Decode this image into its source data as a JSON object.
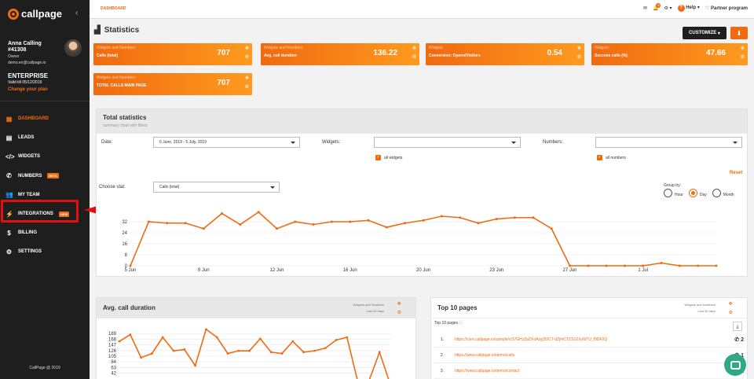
{
  "sidebar": {
    "brand": "callpage",
    "user_name": "Anna Calling",
    "user_id": "#41308",
    "user_role": "Owner",
    "user_email": "demo.en@callpage.io",
    "plan_name": "ENTERPRISE",
    "plan_valid": "Valid till 05/12/2019",
    "change_plan": "Change your plan",
    "items": [
      {
        "label": "DASHBOARD",
        "icon": "dashboard-icon",
        "glyph": "▦"
      },
      {
        "label": "LEADS",
        "icon": "leads-icon",
        "glyph": "▤"
      },
      {
        "label": "WIDGETS",
        "icon": "code-icon",
        "glyph": "</>"
      },
      {
        "label": "NUMBERS",
        "icon": "phone-icon",
        "glyph": "✆",
        "badge": "BETA"
      },
      {
        "label": "MY TEAM",
        "icon": "team-icon",
        "glyph": "👥"
      },
      {
        "label": "INTEGRATIONS",
        "icon": "plug-icon",
        "glyph": "⚡",
        "badge": "NEW"
      },
      {
        "label": "BILLING",
        "icon": "dollar-icon",
        "glyph": "$"
      },
      {
        "label": "SETTINGS",
        "icon": "gear-icon",
        "glyph": "⚙"
      }
    ],
    "copyright": "CallPage @ 2019"
  },
  "topbar": {
    "breadcrumb": "DASHBOARD",
    "notif_count": "8",
    "help": "Help",
    "partner": "Partner program"
  },
  "stats": {
    "title": "Statistics",
    "customize": "CUSTOMIZE",
    "widgets": [
      {
        "tag": "Widgets and Numbers",
        "label": "Calls (total)",
        "value": "707"
      },
      {
        "tag": "Widgets and Numbers",
        "label": "Avg. call duration",
        "value": "136.22"
      },
      {
        "tag": "Widgets",
        "label": "Conversion: Opens/Visitors",
        "value": "0.54"
      },
      {
        "tag": "Widgets",
        "label": "Success calls (%)",
        "value": "47.66"
      },
      {
        "tag": "Widgets and Numbers",
        "label": "TOTAL CALLS MAIN PAGE",
        "value": "707"
      }
    ]
  },
  "total": {
    "title": "Total statistics",
    "subtitle": "summary chart with filters",
    "date_label": "Date:",
    "date_value": "6 June, 2019 - 5 July, 2019",
    "widgets_label": "Widgets:",
    "all_widgets": "all widgets",
    "numbers_label": "Numbers:",
    "all_numbers": "all numbers",
    "reset": "Reset",
    "choose_stat": "Choose stat:",
    "stat_value": "Calls (total)",
    "group_by": "Group by:",
    "group_options": [
      "Hour",
      "Day",
      "Month"
    ],
    "group_selected": "Day"
  },
  "avg": {
    "title": "Avg. call duration",
    "tag1": "Widgets and Numbers",
    "tag2": "Last 30 days"
  },
  "top10": {
    "title": "Top 10 pages",
    "tag1": "Widgets and Numbers",
    "tag2": "Last 30 days",
    "subtitle": "Top 10 pages",
    "rows": [
      {
        "n": "1.",
        "url": "https://core.callpage.io/sample/cO7GHzZpZXoAzyj3OC7-dZjmCTZS1ZXyIbTU_f9DF0Q",
        "count": "2"
      },
      {
        "n": "2.",
        "url": "https://www.callpage.io/demo/calls",
        "count": "1"
      },
      {
        "n": "3.",
        "url": "https://www.callpage.io/demo/contact",
        "count": "1"
      }
    ]
  },
  "chart_data": [
    {
      "type": "line",
      "title": "",
      "xlabel": "",
      "ylabel": "",
      "ylim": [
        0,
        40
      ],
      "yticks": [
        0,
        8,
        16,
        24,
        32
      ],
      "xticks": [
        "5 Jun",
        "9 Jun",
        "12 Jun",
        "16 Jun",
        "20 Jun",
        "23 Jun",
        "27 Jun",
        "1 Jul"
      ],
      "xtick_index": [
        0,
        4,
        8,
        12,
        16,
        20,
        24,
        28
      ],
      "color": "#f06a10",
      "values": [
        0,
        32,
        31,
        31,
        27,
        38,
        30,
        39,
        27,
        32,
        30,
        32,
        32,
        33,
        28,
        31,
        33,
        36,
        35,
        31,
        34,
        35,
        35,
        27,
        0,
        0,
        0,
        0,
        0,
        2,
        0,
        0,
        0
      ]
    },
    {
      "type": "line",
      "title": "",
      "xlabel": "",
      "ylabel": "",
      "ylim": [
        0,
        210
      ],
      "yticks": [
        42,
        63,
        84,
        105,
        126,
        147,
        168,
        189
      ],
      "yticklabels": [
        "42",
        "63",
        "84",
        "105",
        "126",
        "147",
        "168",
        "189"
      ],
      "color": "#f06a10",
      "values": [
        160,
        185,
        100,
        115,
        175,
        125,
        130,
        70,
        205,
        175,
        115,
        125,
        125,
        170,
        120,
        115,
        160,
        120,
        125,
        135,
        165,
        175,
        10,
        10,
        120,
        0
      ]
    }
  ]
}
